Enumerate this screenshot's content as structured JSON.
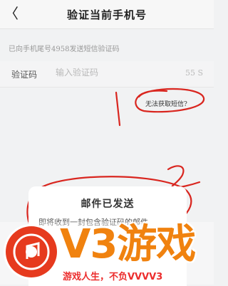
{
  "header": {
    "back_icon": "chevron-left-icon",
    "back_glyph": "〈",
    "title": "验证当前手机号"
  },
  "hint": "已向手机尾号4958发送短信验证码",
  "code_row": {
    "label": "验证码",
    "placeholder": "输入验证码",
    "countdown": "55 S"
  },
  "no_sms_link": "无法获取短信?",
  "annotations": {
    "mark_1": "1",
    "mark_2": "2"
  },
  "dialog": {
    "title": "邮件已发送",
    "body": "即将收到一封包含验证码的邮件"
  },
  "watermark": {
    "logo": "V3游戏",
    "slogan": "游戏人生，不负VVVV3",
    "logo_color": "#f0820f",
    "slogan_color": "#ec2d2d",
    "disc_color": "#e63a1e"
  },
  "colors": {
    "annotation_red": "#d9261f",
    "background": "#f1f2f3"
  }
}
